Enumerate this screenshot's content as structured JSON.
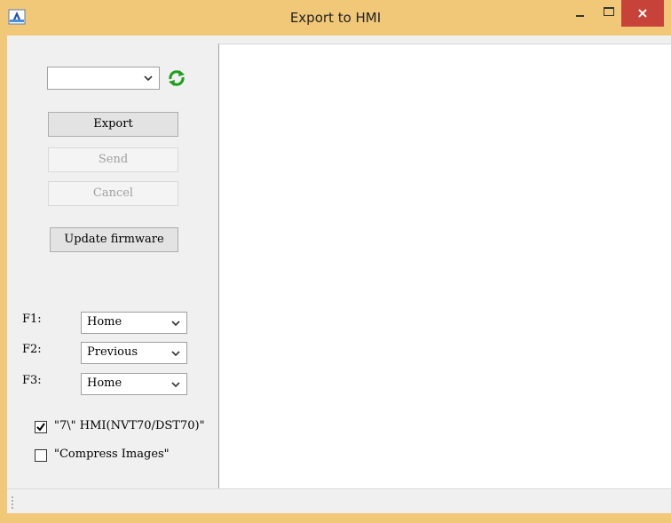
{
  "window": {
    "title": "Export to HMI",
    "controls": {
      "minimize": "–",
      "maximize": "□",
      "close": "×"
    },
    "frame_color": "#f0c878",
    "close_color": "#c7433a"
  },
  "app_icon": "app-logo-icon",
  "device_select": {
    "value": "",
    "refresh_icon": "refresh-icon",
    "refresh_color": "#1e9e1e"
  },
  "buttons": {
    "export": "Export",
    "send": "Send",
    "cancel": "Cancel",
    "update_firmware": "Update firmware"
  },
  "function_keys": [
    {
      "label": "F1:",
      "value": "Home"
    },
    {
      "label": "F2:",
      "value": "Previous"
    },
    {
      "label": "F3:",
      "value": "Home"
    }
  ],
  "options": [
    {
      "label": "\"7\\\" HMI(NVT70/DST70)\"",
      "checked": true
    },
    {
      "label": "\"Compress Images\"",
      "checked": false
    }
  ],
  "log": {
    "content": ""
  }
}
